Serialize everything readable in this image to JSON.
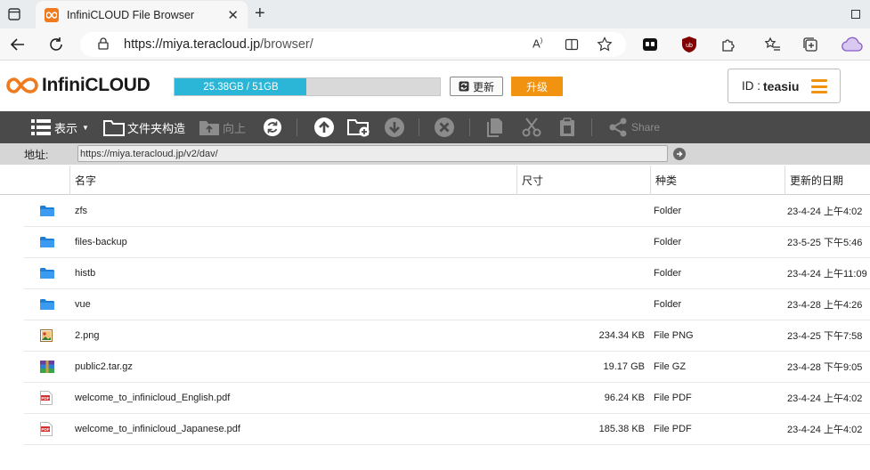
{
  "browser": {
    "tab_title": "InfiniCLOUD File Browser",
    "url_host": "https://miya.teracloud.jp",
    "url_path": "/browser/"
  },
  "header": {
    "logo_text": "InfiniCLOUD",
    "storage_text": "25.38GB / 51GB",
    "storage_used_fraction": 0.498,
    "refresh_label": "更新",
    "upgrade_label": "升级",
    "user_label": "ID :",
    "user_name": "teasiu",
    "accent_color": "#f29211",
    "storage_color": "#2bb6d8"
  },
  "toolbar": {
    "view_label": "表示",
    "folder_struct_label": "文件夹构造",
    "up_label": "向上",
    "share_label": "Share"
  },
  "path": {
    "label": "地址:",
    "value": "https://miya.teracloud.jp/v2/dav/"
  },
  "table": {
    "headers": {
      "name": "名字",
      "size": "尺寸",
      "type": "种类",
      "date": "更新的日期"
    },
    "rows": [
      {
        "icon": "folder-icon",
        "name": "zfs",
        "size": "",
        "type": "Folder",
        "date": "23-4-24 上午4:02"
      },
      {
        "icon": "folder-icon",
        "name": "files-backup",
        "size": "",
        "type": "Folder",
        "date": "23-5-25 下午5:46"
      },
      {
        "icon": "folder-icon",
        "name": "histb",
        "size": "",
        "type": "Folder",
        "date": "23-4-24 上午11:09"
      },
      {
        "icon": "folder-icon",
        "name": "vue",
        "size": "",
        "type": "Folder",
        "date": "23-4-28 上午4:26"
      },
      {
        "icon": "image-file-icon",
        "name": "2.png",
        "size": "234.34 KB",
        "type": "File PNG",
        "date": "23-4-25 下午7:58"
      },
      {
        "icon": "archive-file-icon",
        "name": "public2.tar.gz",
        "size": "19.17 GB",
        "type": "File GZ",
        "date": "23-4-28 下午9:05"
      },
      {
        "icon": "pdf-file-icon",
        "name": "welcome_to_infinicloud_English.pdf",
        "size": "96.24 KB",
        "type": "File PDF",
        "date": "23-4-24 上午4:02"
      },
      {
        "icon": "pdf-file-icon",
        "name": "welcome_to_infinicloud_Japanese.pdf",
        "size": "185.38 KB",
        "type": "File PDF",
        "date": "23-4-24 上午4:02"
      }
    ]
  }
}
